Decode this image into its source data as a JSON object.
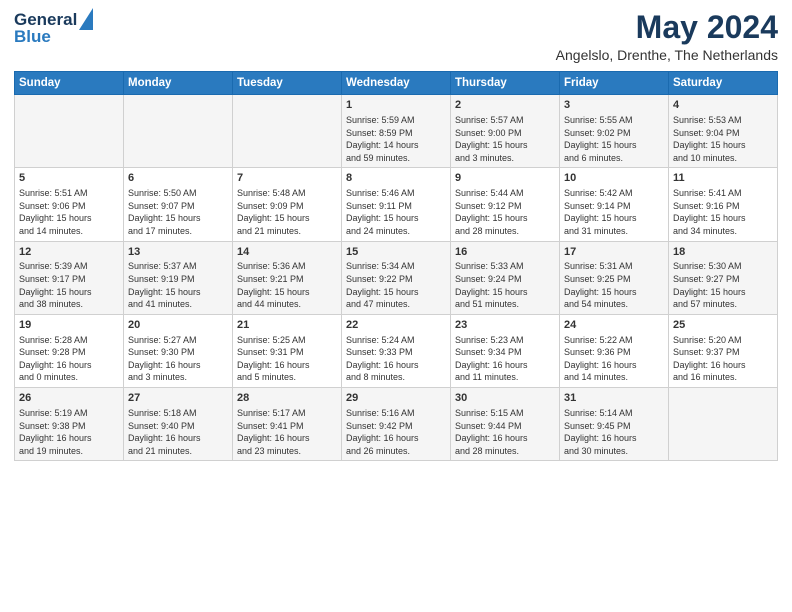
{
  "logo": {
    "line1": "General",
    "line2": "Blue"
  },
  "title": "May 2024",
  "subtitle": "Angelslo, Drenthe, The Netherlands",
  "days_of_week": [
    "Sunday",
    "Monday",
    "Tuesday",
    "Wednesday",
    "Thursday",
    "Friday",
    "Saturday"
  ],
  "weeks": [
    [
      {
        "day": "",
        "info": ""
      },
      {
        "day": "",
        "info": ""
      },
      {
        "day": "",
        "info": ""
      },
      {
        "day": "1",
        "info": "Sunrise: 5:59 AM\nSunset: 8:59 PM\nDaylight: 14 hours\nand 59 minutes."
      },
      {
        "day": "2",
        "info": "Sunrise: 5:57 AM\nSunset: 9:00 PM\nDaylight: 15 hours\nand 3 minutes."
      },
      {
        "day": "3",
        "info": "Sunrise: 5:55 AM\nSunset: 9:02 PM\nDaylight: 15 hours\nand 6 minutes."
      },
      {
        "day": "4",
        "info": "Sunrise: 5:53 AM\nSunset: 9:04 PM\nDaylight: 15 hours\nand 10 minutes."
      }
    ],
    [
      {
        "day": "5",
        "info": "Sunrise: 5:51 AM\nSunset: 9:06 PM\nDaylight: 15 hours\nand 14 minutes."
      },
      {
        "day": "6",
        "info": "Sunrise: 5:50 AM\nSunset: 9:07 PM\nDaylight: 15 hours\nand 17 minutes."
      },
      {
        "day": "7",
        "info": "Sunrise: 5:48 AM\nSunset: 9:09 PM\nDaylight: 15 hours\nand 21 minutes."
      },
      {
        "day": "8",
        "info": "Sunrise: 5:46 AM\nSunset: 9:11 PM\nDaylight: 15 hours\nand 24 minutes."
      },
      {
        "day": "9",
        "info": "Sunrise: 5:44 AM\nSunset: 9:12 PM\nDaylight: 15 hours\nand 28 minutes."
      },
      {
        "day": "10",
        "info": "Sunrise: 5:42 AM\nSunset: 9:14 PM\nDaylight: 15 hours\nand 31 minutes."
      },
      {
        "day": "11",
        "info": "Sunrise: 5:41 AM\nSunset: 9:16 PM\nDaylight: 15 hours\nand 34 minutes."
      }
    ],
    [
      {
        "day": "12",
        "info": "Sunrise: 5:39 AM\nSunset: 9:17 PM\nDaylight: 15 hours\nand 38 minutes."
      },
      {
        "day": "13",
        "info": "Sunrise: 5:37 AM\nSunset: 9:19 PM\nDaylight: 15 hours\nand 41 minutes."
      },
      {
        "day": "14",
        "info": "Sunrise: 5:36 AM\nSunset: 9:21 PM\nDaylight: 15 hours\nand 44 minutes."
      },
      {
        "day": "15",
        "info": "Sunrise: 5:34 AM\nSunset: 9:22 PM\nDaylight: 15 hours\nand 47 minutes."
      },
      {
        "day": "16",
        "info": "Sunrise: 5:33 AM\nSunset: 9:24 PM\nDaylight: 15 hours\nand 51 minutes."
      },
      {
        "day": "17",
        "info": "Sunrise: 5:31 AM\nSunset: 9:25 PM\nDaylight: 15 hours\nand 54 minutes."
      },
      {
        "day": "18",
        "info": "Sunrise: 5:30 AM\nSunset: 9:27 PM\nDaylight: 15 hours\nand 57 minutes."
      }
    ],
    [
      {
        "day": "19",
        "info": "Sunrise: 5:28 AM\nSunset: 9:28 PM\nDaylight: 16 hours\nand 0 minutes."
      },
      {
        "day": "20",
        "info": "Sunrise: 5:27 AM\nSunset: 9:30 PM\nDaylight: 16 hours\nand 3 minutes."
      },
      {
        "day": "21",
        "info": "Sunrise: 5:25 AM\nSunset: 9:31 PM\nDaylight: 16 hours\nand 5 minutes."
      },
      {
        "day": "22",
        "info": "Sunrise: 5:24 AM\nSunset: 9:33 PM\nDaylight: 16 hours\nand 8 minutes."
      },
      {
        "day": "23",
        "info": "Sunrise: 5:23 AM\nSunset: 9:34 PM\nDaylight: 16 hours\nand 11 minutes."
      },
      {
        "day": "24",
        "info": "Sunrise: 5:22 AM\nSunset: 9:36 PM\nDaylight: 16 hours\nand 14 minutes."
      },
      {
        "day": "25",
        "info": "Sunrise: 5:20 AM\nSunset: 9:37 PM\nDaylight: 16 hours\nand 16 minutes."
      }
    ],
    [
      {
        "day": "26",
        "info": "Sunrise: 5:19 AM\nSunset: 9:38 PM\nDaylight: 16 hours\nand 19 minutes."
      },
      {
        "day": "27",
        "info": "Sunrise: 5:18 AM\nSunset: 9:40 PM\nDaylight: 16 hours\nand 21 minutes."
      },
      {
        "day": "28",
        "info": "Sunrise: 5:17 AM\nSunset: 9:41 PM\nDaylight: 16 hours\nand 23 minutes."
      },
      {
        "day": "29",
        "info": "Sunrise: 5:16 AM\nSunset: 9:42 PM\nDaylight: 16 hours\nand 26 minutes."
      },
      {
        "day": "30",
        "info": "Sunrise: 5:15 AM\nSunset: 9:44 PM\nDaylight: 16 hours\nand 28 minutes."
      },
      {
        "day": "31",
        "info": "Sunrise: 5:14 AM\nSunset: 9:45 PM\nDaylight: 16 hours\nand 30 minutes."
      },
      {
        "day": "",
        "info": ""
      }
    ]
  ]
}
